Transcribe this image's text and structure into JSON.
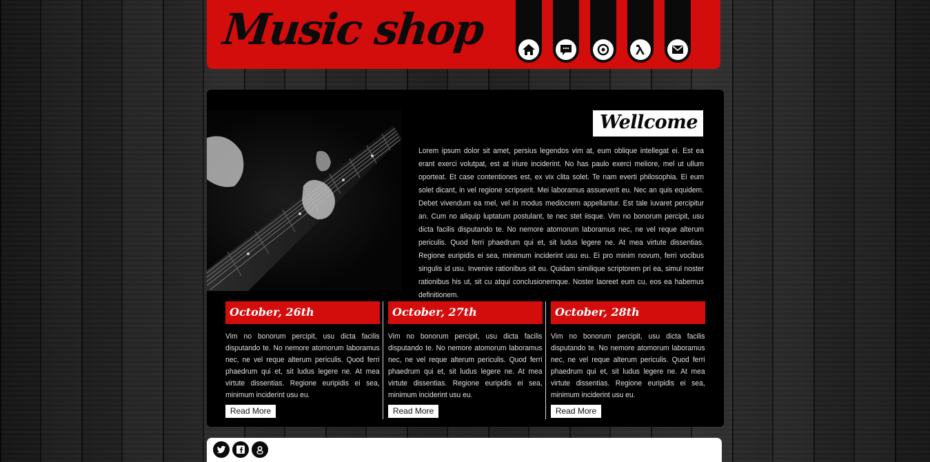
{
  "header": {
    "logo_text": "Music shop",
    "brand_color": "#d30c0c",
    "nav": [
      {
        "icon": "home-icon"
      },
      {
        "icon": "chat-icon"
      },
      {
        "icon": "target-icon"
      },
      {
        "icon": "lambda-icon"
      },
      {
        "icon": "mail-icon"
      }
    ]
  },
  "main": {
    "welcome_title": "Wellcome",
    "intro_text": "Lorem ipsum dolor sit amet, persius legendos vim at, eum oblique intellegat ei. Est ea erant exerci volutpat, est at iriure inciderint. No has paulo exerci meliore, mel ut ullum oporteat. Et case contentiones est, ex vix clita solet. Te nam everti philosophia. Ei eum solet dicant, in vel regione scripserit. Mei laboramus assueverit eu. Nec an quis equidem. Debet vivendum ea mel, vel in modus mediocrem appellantur. Est tale iuvaret percipitur an. Cum no aliquip luptatum postulant, te nec stet iisque. Vim no bonorum percipit, usu dicta facilis disputando te. No nemore atomorum laboramus nec, ne vel reque alterum periculis. Quod ferri phaedrum qui et, sit ludus legere ne. At mea virtute dissentias. Regione euripidis ei sea, minimum inciderint usu eu. Ei pro minim novum, ferri vocibus singulis id usu. Invenire rationibus sit eu. Quidam similique scriptorem pri ea, simul noster rationibus his ut, sit cu atqui conclusionemque. Noster laoreet eum cu, eos ea habemus definitionem.",
    "news": [
      {
        "date": "October, 26th",
        "text": "Vim no bonorum percipit, usu dicta facilis disputando te. No nemore atomorum laboramus nec, ne vel reque alterum periculis. Quod ferri phaedrum qui et, sit ludus legere ne. At mea virtute dissentias. Regione euripidis ei sea, minimum inciderint usu eu.",
        "button": "Read More"
      },
      {
        "date": "October, 27th",
        "text": "Vim no bonorum percipit, usu dicta facilis disputando te. No nemore atomorum laboramus nec, ne vel reque alterum periculis. Quod ferri phaedrum qui et, sit ludus legere ne. At mea virtute dissentias. Regione euripidis ei sea, minimum inciderint usu eu.",
        "button": "Read More"
      },
      {
        "date": "October, 28th",
        "text": "Vim no bonorum percipit, usu dicta facilis disputando te. No nemore atomorum laboramus nec, ne vel reque alterum periculis. Quod ferri phaedrum qui et, sit ludus legere ne. At mea virtute dissentias. Regione euripidis ei sea, minimum inciderint usu eu.",
        "button": "Read More"
      }
    ]
  },
  "footer": {
    "social": [
      {
        "icon": "twitter-icon"
      },
      {
        "icon": "facebook-icon"
      },
      {
        "icon": "google-plus-icon"
      }
    ]
  }
}
